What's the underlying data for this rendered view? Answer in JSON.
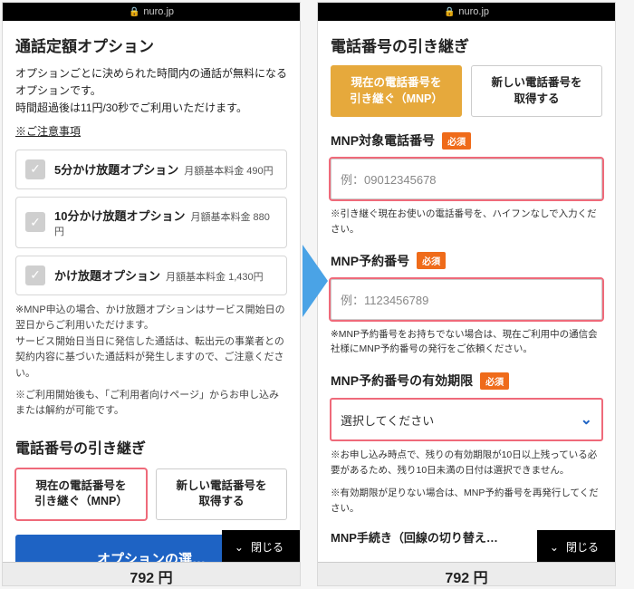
{
  "url": "nuro.jp",
  "left": {
    "heading": "通話定額オプション",
    "desc": "オプションごとに決められた時間内の通話が無料になるオプションです。\n時間超過後は11円/30秒でご利用いただけます。",
    "note_link": "※ご注意事項",
    "options": [
      {
        "title": "5分かけ放題オプション",
        "price": "月額基本料金 490円"
      },
      {
        "title": "10分かけ放題オプション",
        "price": "月額基本料金 880円"
      },
      {
        "title": "かけ放題オプション",
        "price": "月額基本料金 1,430円"
      }
    ],
    "fine1": "※MNP申込の場合、かけ放題オプションはサービス開始日の翌日からご利用いただけます。\nサービス開始日当日に発信した通話は、転出元の事業者との契約内容に基づいた通話料が発生しますので、ご注意ください。",
    "fine2": "※ご利用開始後も、「ご利用者向けページ」からお申し込みまたは解約が可能です。",
    "section": "電話番号の引き継ぎ",
    "tab_mnp": "現在の電話番号を\n引き継ぐ（MNP）",
    "tab_new": "新しい電話番号を\n取得する",
    "primary": "オプションの選…",
    "close": "閉じる",
    "price": "792 円"
  },
  "right": {
    "heading": "電話番号の引き継ぎ",
    "tab_mnp": "現在の電話番号を\n引き継ぐ（MNP）",
    "tab_new": "新しい電話番号を\n取得する",
    "f1_label": "MNP対象電話番号",
    "f1_placeholder": "例：09012345678",
    "f1_help": "※引き継ぐ現在お使いの電話番号を、ハイフンなしで入力ください。",
    "f2_label": "MNP予約番号",
    "f2_placeholder": "例：1123456789",
    "f2_help": "※MNP予約番号をお持ちでない場合は、現在ご利用中の通信会社様にMNP予約番号の発行をご依頼ください。",
    "f3_label": "MNP予約番号の有効期限",
    "f3_value": "選択してください",
    "f3_help1": "※お申し込み時点で、残りの有効期限が10日以上残っている必要があるため、残り10日未満の日付は選択できません。",
    "f3_help2": "※有効期限が足りない場合は、MNP予約番号を再発行してください。",
    "cutoff": "MNP手続き（回線の切り替え…",
    "req": "必須",
    "close": "閉じる",
    "price": "792 円"
  }
}
